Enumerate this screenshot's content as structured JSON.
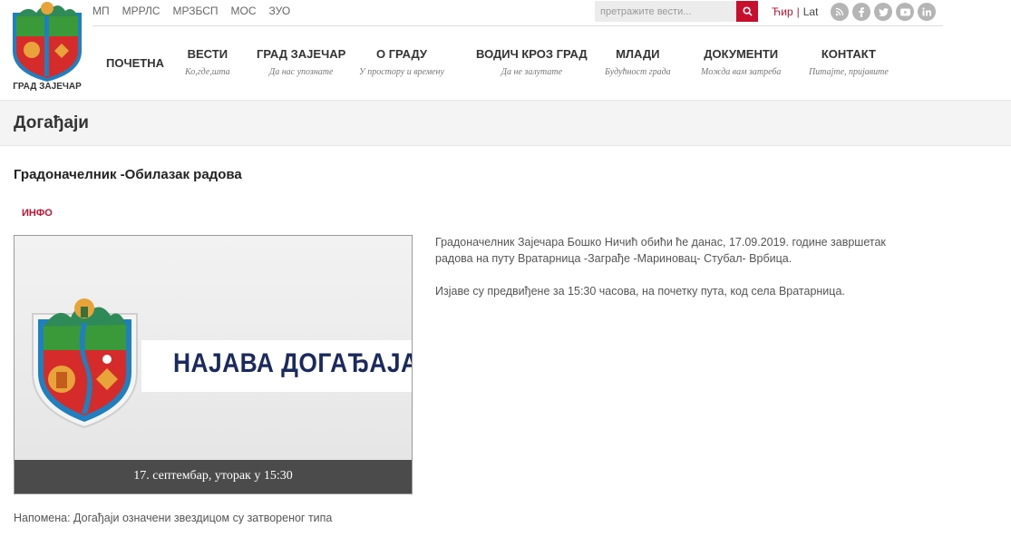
{
  "header": {
    "logo_text": "ГРАД ЗАЈЕЧАР",
    "top_links": [
      "МП",
      "МРРЛС",
      "МРЗБСП",
      "МОС",
      "ЗУО"
    ],
    "search_placeholder": "претражите вести...",
    "lang": {
      "cyr": "Ћир",
      "separator": "|",
      "lat": "Lat"
    },
    "social_icons": [
      "rss-icon",
      "facebook-icon",
      "twitter-icon",
      "youtube-icon",
      "linkedin-icon"
    ],
    "nav": [
      {
        "title": "ПОЧЕТНА",
        "subtitle": ""
      },
      {
        "title": "ВЕСТИ",
        "subtitle": "Ко,где,шта"
      },
      {
        "title": "ГРАД ЗАЈЕЧАР",
        "subtitle": "Да нас упознате"
      },
      {
        "title": "О ГРАДУ",
        "subtitle": "У простору и времену"
      },
      {
        "title": "ВОДИЧ КРОЗ ГРАД",
        "subtitle": "Да не залутате"
      },
      {
        "title": "МЛАДИ",
        "subtitle": "Будућност града"
      },
      {
        "title": "ДОКУМЕНТИ",
        "subtitle": "Можда вам затреба"
      },
      {
        "title": "КОНТАКТ",
        "subtitle": "Питајте, пријавите"
      }
    ]
  },
  "page": {
    "section_title": "Догађаји",
    "article_title": "Градоначелник -Обилазак радова",
    "tag": "ИНФО",
    "image": {
      "banner_text": "НАЈАВА ДОГАЂАЈА",
      "caption": "17. септембар, уторак у 15:30"
    },
    "body": [
      "Градоначелник Зајечара Бошко Ничић обићи ће данас, 17.09.2019. године завршетак радова на путу Вратарница -Заграђе -Мариновац- Стубал- Врбица.",
      "Изјаве су предвиђене за 15:30 часова, на почетку пута, код села Вратарница."
    ],
    "note": "Напомена: Догађаји означени звездицом су затвореног типа"
  },
  "colors": {
    "accent": "#c8102e",
    "nav_text": "#333333",
    "banner_text": "#1a2a5e",
    "caption_bar": "#4b4b4b"
  }
}
